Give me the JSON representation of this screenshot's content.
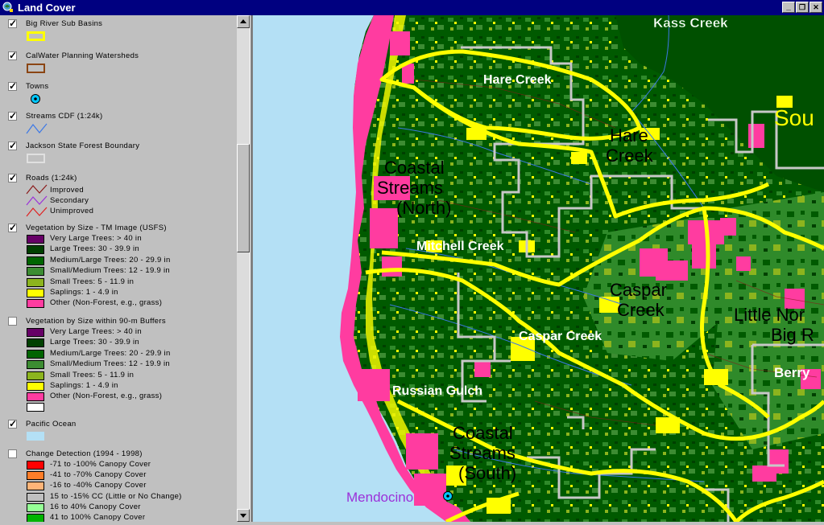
{
  "window": {
    "title": "Land Cover",
    "buttons": {
      "minimize": "_",
      "restore": "❐",
      "close": "✕"
    }
  },
  "toc": {
    "layers": [
      {
        "name": "Big River Sub Basins",
        "checked": true
      },
      {
        "name": "CalWater Planning Watersheds",
        "checked": true
      },
      {
        "name": "Towns",
        "checked": true
      },
      {
        "name": "Streams CDF (1:24k)",
        "checked": true
      },
      {
        "name": "Jackson State Forest Boundary",
        "checked": true
      },
      {
        "name": "Roads (1:24k)",
        "checked": true
      },
      {
        "name": "Vegetation by Size - TM Image (USFS)",
        "checked": true
      },
      {
        "name": "Vegetation by Size within 90-m Buffers",
        "checked": false
      },
      {
        "name": "Pacific Ocean",
        "checked": true
      },
      {
        "name": "Change Detection (1994 - 1998)",
        "checked": false
      }
    ],
    "roads_classes": [
      "Improved",
      "Secondary",
      "Unimproved"
    ],
    "veg_classes": [
      {
        "label": "Very Large Trees: > 40  in",
        "color": "#660066"
      },
      {
        "label": "Large Trees: 30 - 39.9 in",
        "color": "#004000"
      },
      {
        "label": "Medium/Large Trees: 20 - 29.9 in",
        "color": "#006400"
      },
      {
        "label": "Small/Medium Trees: 12 - 19.9 in",
        "color": "#3c8c32"
      },
      {
        "label": "Small Trees: 5 - 11.9 in",
        "color": "#8cb41e"
      },
      {
        "label": "Saplings: 1 - 4.9 in",
        "color": "#ffff00"
      },
      {
        "label": "Other (Non-Forest, e.g., grass)",
        "color": "#ff3ca0"
      }
    ],
    "change_classes": [
      {
        "label": "-71 to -100% Canopy Cover",
        "color": "#ff0000"
      },
      {
        "label": "-41 to -70% Canopy Cover",
        "color": "#ff7d28"
      },
      {
        "label": "-16 to -40% Canopy Cover",
        "color": "#ffb478"
      },
      {
        "label": "15 to -15% CC (Little or No Change)",
        "color": "#c0c0c0"
      },
      {
        "label": "16 to 40% Canopy Cover",
        "color": "#96ff96"
      },
      {
        "label": "41 to 100% Canopy Cover",
        "color": "#00b400"
      }
    ]
  },
  "map": {
    "labels": {
      "kass_creek": "Kass Creek",
      "hare_creek_small": "Hare Creek",
      "hare_creek_line1": "Hare",
      "hare_creek_line2": "Creek",
      "south": "Sou",
      "coastal_north_1": "Coastal",
      "coastal_north_2": "Streams",
      "coastal_north_3": "(North)",
      "mitchell_creek": "Mitchell Creek",
      "caspar_line1": "Caspar",
      "caspar_line2": "Creek",
      "caspar_creek_small": "Caspar Creek",
      "little_north_1": "Little Nor",
      "little_north_2": "Big R",
      "berry": "Berry",
      "russian_gulch": "Russian Gulch",
      "coastal_south_1": "Coastal",
      "coastal_south_2": "Streams",
      "coastal_south_3": "(South)",
      "mendocino": "Mendocino"
    },
    "colors": {
      "ocean": "#b4e0f5",
      "forest_dark": "#005a00",
      "forest_mid": "#2f8a2a",
      "saplings": "#ffff00",
      "other": "#ff3ca0",
      "basin_boundary": "#ffff00",
      "jsf_boundary": "#c8c8c8",
      "town": "#9b30d9"
    }
  }
}
